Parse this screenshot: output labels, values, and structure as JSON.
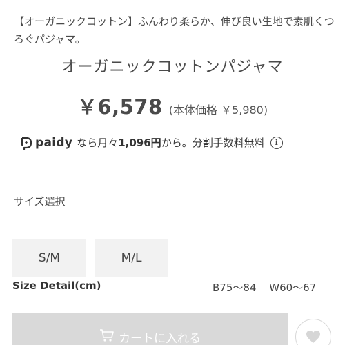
{
  "product": {
    "tagline": "【オーガニックコットン】ふんわり柔らか、伸び良い生地で素肌くつろぐパジャマ。",
    "title": "オーガニックコットンパジャマ",
    "price": "￥6,578",
    "price_excl_tax": "(本体価格 ￥5,980)"
  },
  "paidy": {
    "logo_text": "paidy",
    "prefix": "なら月々",
    "amount": "1,096円",
    "suffix": "から。分割手数料無料",
    "info_icon": "info-icon"
  },
  "size": {
    "label": "サイズ選択",
    "options": [
      "S/M",
      "M/L"
    ],
    "detail_label": "Size Detail(cm)",
    "bust": "B75～84",
    "waist": "W60～67"
  },
  "cart": {
    "label": "カートに入れる",
    "icon": "cart-icon"
  },
  "favorite": {
    "icon": "heart-icon"
  },
  "colors": {
    "text": "#4a4a4a",
    "size_button_bg": "#f2f2f2",
    "cart_button_bg": "#d9d9d9"
  }
}
